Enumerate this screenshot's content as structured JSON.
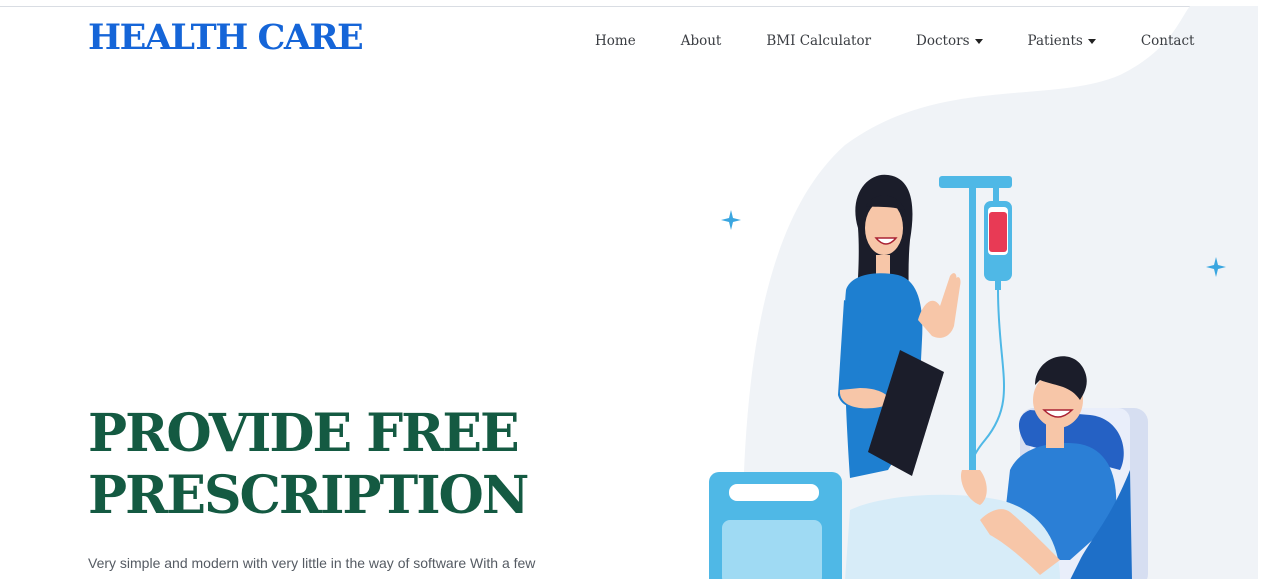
{
  "brand": {
    "name": "HEALTH CARE"
  },
  "nav": {
    "items": [
      {
        "label": "Home",
        "has_dropdown": false
      },
      {
        "label": "About",
        "has_dropdown": false
      },
      {
        "label": "BMI Calculator",
        "has_dropdown": false
      },
      {
        "label": "Doctors",
        "has_dropdown": true
      },
      {
        "label": "Patients",
        "has_dropdown": true
      },
      {
        "label": "Contact",
        "has_dropdown": false
      }
    ]
  },
  "hero": {
    "title_line1": "PROVIDE FREE",
    "title_line2": "PRESCRIPTION",
    "text": "Very simple and modern with very little in the way of software With a few"
  },
  "illustration": {
    "subject": "nurse-and-patient-illustration",
    "icons": [
      "sparkle-icon",
      "iv-drip-icon",
      "hospital-bed-icon"
    ]
  },
  "colors": {
    "brand": "#1565d8",
    "hero_title": "#145a42",
    "nav_text": "#3a3d42",
    "body_text": "#555b63",
    "background_shape": "#f0f3f7",
    "scrub_blue": "#1e7fd0",
    "light_blue": "#4fb8e6"
  }
}
